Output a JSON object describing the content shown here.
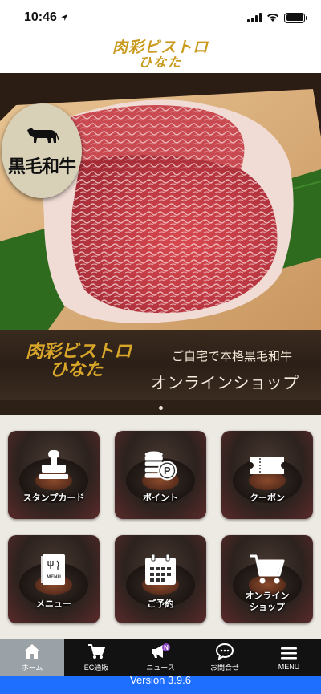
{
  "status_bar": {
    "time": "10:46"
  },
  "header": {
    "logo_line1": "肉彩ビストロ",
    "logo_line2": "ひなた"
  },
  "hero": {
    "badge_text": "黒毛和牛"
  },
  "banner": {
    "logo_line1": "肉彩ビストロ",
    "logo_line2": "ひなた",
    "subtitle": "ご自宅で本格黒毛和牛",
    "title": "オンラインショップ"
  },
  "menu_tiles": [
    {
      "label": "スタンプカード",
      "icon": "stamp-icon"
    },
    {
      "label": "ポイント",
      "icon": "points-coin-icon"
    },
    {
      "label": "クーポン",
      "icon": "coupon-ticket-icon"
    },
    {
      "label": "メニュー",
      "icon": "menu-book-icon"
    },
    {
      "label": "ご予約",
      "icon": "calendar-icon"
    },
    {
      "label_line1": "オンライン",
      "label_line2": "ショップ",
      "icon": "shopping-cart-icon"
    }
  ],
  "tabbar": {
    "items": [
      {
        "label": "ホーム",
        "icon": "home-icon",
        "active": true
      },
      {
        "label": "EC通販",
        "icon": "cart-icon"
      },
      {
        "label": "ニュース",
        "icon": "megaphone-icon",
        "badge": "N"
      },
      {
        "label": "お問合せ",
        "icon": "chat-bubble-icon"
      },
      {
        "label": "MENU",
        "icon": "hamburger-icon"
      }
    ]
  },
  "footer": {
    "version": "Version 3.9.6"
  },
  "colors": {
    "brand_gold": "#c99a1e",
    "version_bar": "#1e6eff",
    "active_tab": "#9aa2a7"
  }
}
